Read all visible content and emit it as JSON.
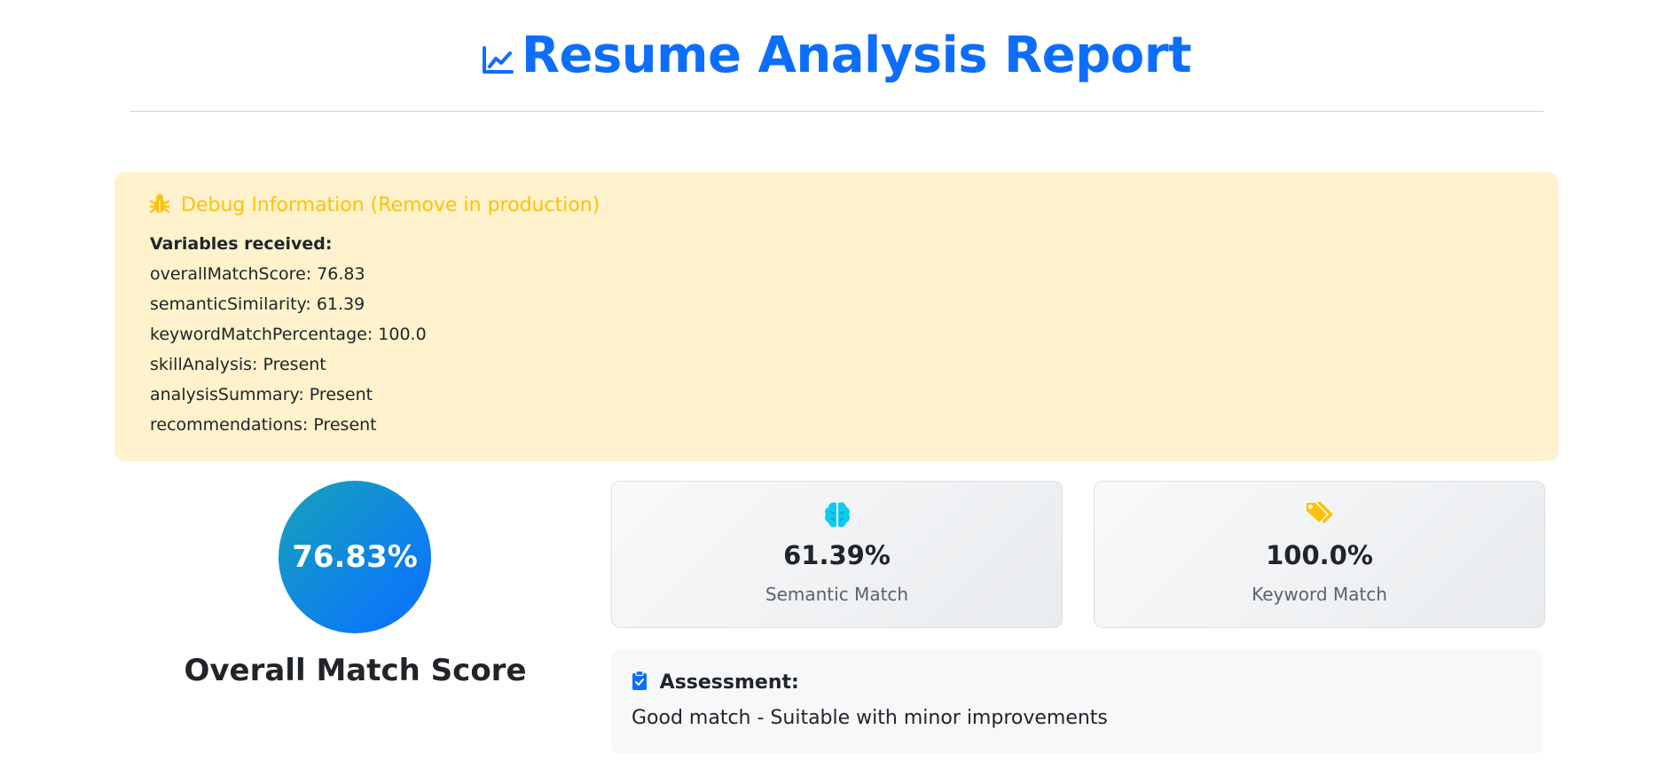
{
  "header": {
    "title": "Resume Analysis Report",
    "icon": "line-chart-icon"
  },
  "debug": {
    "heading": "Debug Information (Remove in production)",
    "icon": "bug-icon",
    "subheading": "Variables received:",
    "lines": [
      "overallMatchScore: 76.83",
      "semanticSimilarity: 61.39",
      "keywordMatchPercentage: 100.0",
      "skillAnalysis: Present",
      "analysisSummary: Present",
      "recommendations: Present"
    ]
  },
  "score": {
    "value": "76.83%",
    "label": "Overall Match Score"
  },
  "cards": {
    "semantic": {
      "value": "61.39%",
      "label": "Semantic Match",
      "icon": "brain-icon"
    },
    "keyword": {
      "value": "100.0%",
      "label": "Keyword Match",
      "icon": "tags-icon"
    }
  },
  "assessment": {
    "heading": "Assessment:",
    "icon": "clipboard-check-icon",
    "text": "Good match - Suitable with minor improvements"
  },
  "colors": {
    "primary": "#0d6efd",
    "warning": "#ffc107",
    "warning_bg": "#fff2cc",
    "info": "#0dcaf0"
  }
}
